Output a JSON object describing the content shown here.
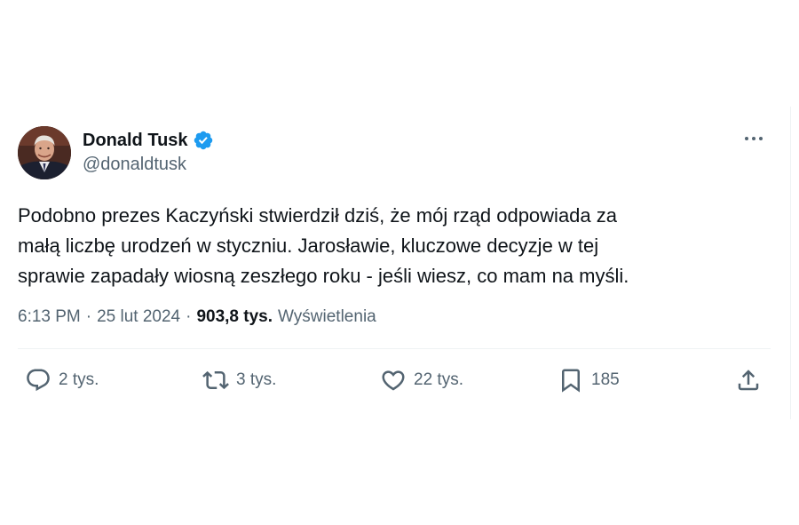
{
  "author": {
    "display_name": "Donald Tusk",
    "handle": "@donaldtusk",
    "verified": true
  },
  "tweet": {
    "text_lines": [
      "Podobno prezes Kaczyński stwierdził dziś, że mój rząd odpowiada za",
      "małą liczbę urodzeń w styczniu. Jarosławie, kluczowe decyzje w tej",
      "sprawie zapadały wiosną zeszłego roku - jeśli wiesz, co mam na myśli."
    ],
    "time": "6:13 PM",
    "separator": "·",
    "date": "25 lut 2024",
    "views_count": "903,8 tys.",
    "views_label": "Wyświetlenia"
  },
  "actions": {
    "replies": "2 tys.",
    "reposts": "3 tys.",
    "likes": "22 tys.",
    "bookmarks": "185"
  },
  "colors": {
    "primary_text": "#0f1419",
    "secondary_text": "#536471",
    "verified_blue": "#1d9bf0",
    "divider": "#eff3f4"
  },
  "icons": {
    "verified": "verified-badge-icon",
    "more": "more-options-icon",
    "reply": "reply-icon",
    "repost": "repost-icon",
    "like": "heart-icon",
    "bookmark": "bookmark-icon",
    "share": "share-icon"
  }
}
